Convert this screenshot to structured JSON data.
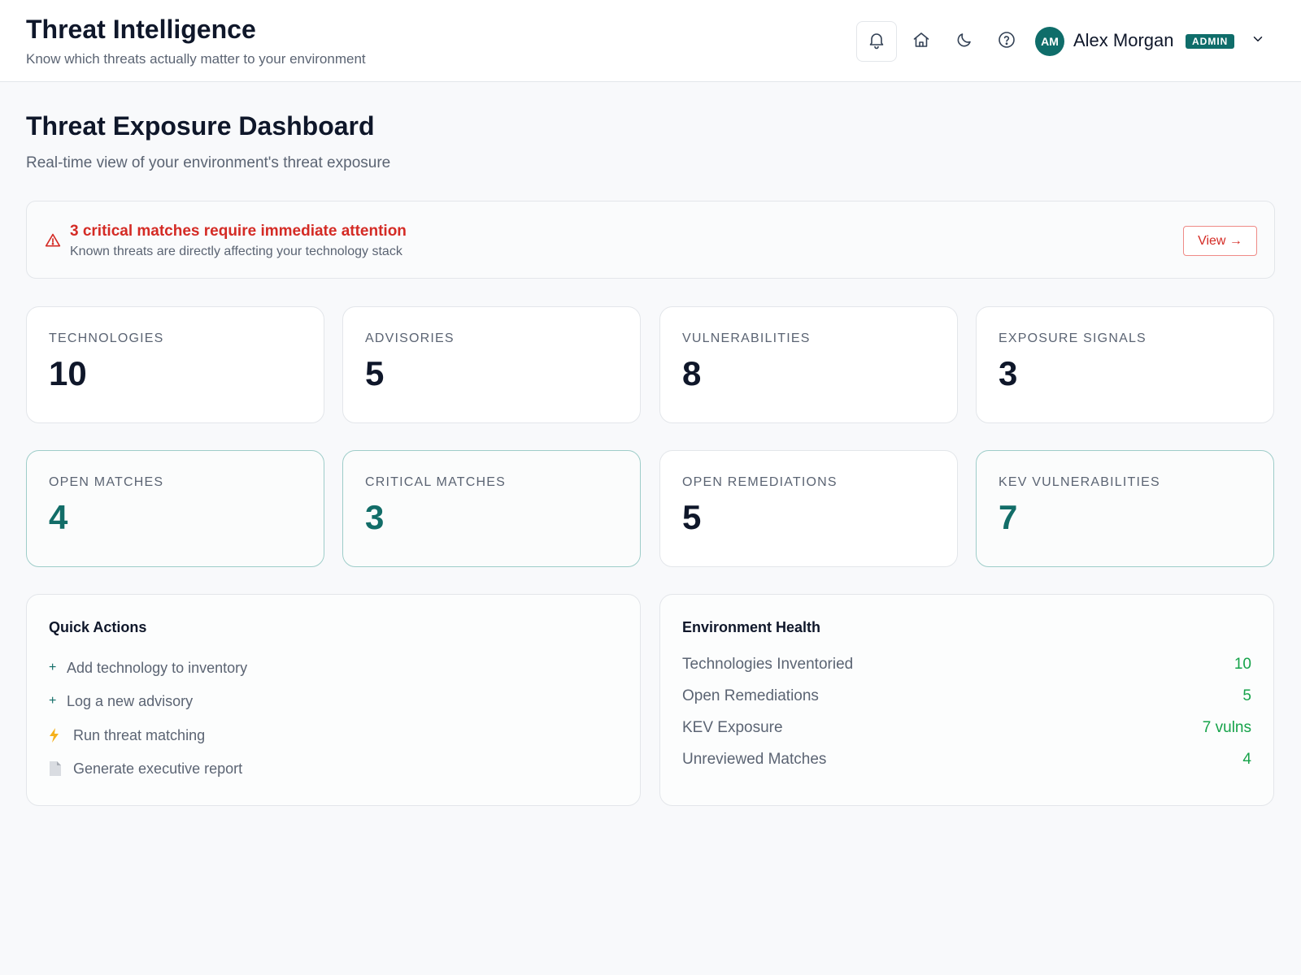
{
  "header": {
    "title": "Threat Intelligence",
    "subtitle": "Know which threats actually matter to your environment",
    "icons": [
      "bell-icon",
      "home-icon",
      "moon-icon",
      "help-icon",
      "chevron-down-icon"
    ],
    "user": {
      "initials": "AM",
      "name": "Alex Morgan",
      "role": "ADMIN"
    }
  },
  "page": {
    "title": "Threat Exposure Dashboard",
    "subtitle": "Real-time view of your environment's threat exposure"
  },
  "alert": {
    "title": "3 critical matches require immediate attention",
    "message": "Known threats are directly affecting your technology stack",
    "button_label": "View →",
    "color": "#d42b25"
  },
  "stats": [
    {
      "label": "TECHNOLOGIES",
      "value": "10"
    },
    {
      "label": "ADVISORIES",
      "value": "5"
    },
    {
      "label": "VULNERABILITIES",
      "value": "8"
    },
    {
      "label": "EXPOSURE SIGNALS",
      "value": "3"
    },
    {
      "label": "OPEN MATCHES",
      "value": "4"
    },
    {
      "label": "CRITICAL MATCHES",
      "value": "3"
    },
    {
      "label": "OPEN REMEDIATIONS",
      "value": "5"
    },
    {
      "label": "KEV VULNERABILITIES",
      "value": "7"
    }
  ],
  "quick_actions": {
    "title": "Quick Actions",
    "items": [
      {
        "icon": "plus-icon",
        "label": "Add technology to inventory"
      },
      {
        "icon": "plus-icon",
        "label": "Log a new advisory"
      },
      {
        "icon": "lightning-icon",
        "label": "Run threat matching"
      },
      {
        "icon": "document-icon",
        "label": "Generate executive report"
      }
    ]
  },
  "environment_health": {
    "title": "Environment Health",
    "rows": [
      {
        "label": "Technologies Inventoried",
        "value": "10"
      },
      {
        "label": "Open Remediations",
        "value": "5"
      },
      {
        "label": "KEV Exposure",
        "value": "7 vulns"
      },
      {
        "label": "Unreviewed Matches",
        "value": "4"
      }
    ]
  },
  "colors": {
    "accent": "#0f6d6a",
    "danger": "#d42b25",
    "success": "#16a34a"
  }
}
